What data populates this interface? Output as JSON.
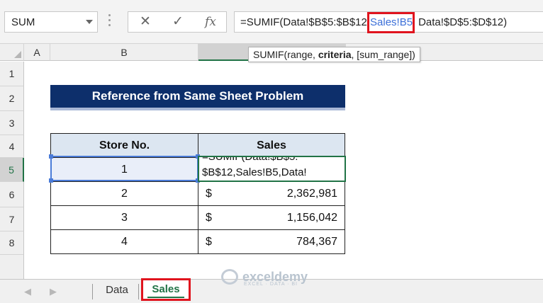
{
  "formula_bar": {
    "name_box": "SUM",
    "cancel_icon": "✕",
    "enter_icon": "✓",
    "fx_label": "fx",
    "formula_prefix": "=SUMIF(Data!$B$5:$B$12,",
    "formula_highlight": "Sales!B5",
    "formula_suffix": "Data!$D$5:$D$12)"
  },
  "columns": [
    "A",
    "B"
  ],
  "tooltip": {
    "prefix": "SUMIF(range, ",
    "bold": "criteria",
    "suffix": ", [sum_range])"
  },
  "rows": [
    "1",
    "2",
    "3",
    "4",
    "5",
    "6",
    "7",
    "8"
  ],
  "sheet": {
    "title": "Reference from Same Sheet Problem",
    "headers": [
      "Store No.",
      "Sales"
    ],
    "editing": {
      "store": "1",
      "line1": "=SUMIF(Data!$B$5:",
      "line2": "$B$12,Sales!B5,Data!"
    },
    "data_rows": [
      {
        "store": "2",
        "currency": "$",
        "sales": "2,362,981"
      },
      {
        "store": "3",
        "currency": "$",
        "sales": "1,156,042"
      },
      {
        "store": "4",
        "currency": "$",
        "sales": "784,367"
      }
    ]
  },
  "tabs": {
    "prev": "◀",
    "next": "▶",
    "items": [
      "Data",
      "Sales"
    ],
    "active": "Sales"
  },
  "watermark": {
    "name": "exceldemy",
    "tagline": "EXCEL · DATA · BI"
  },
  "colors": {
    "title_bg": "#0d2f6b",
    "header_bg": "#dce6f1",
    "excel_green": "#217346",
    "highlight_red": "#e0141e",
    "ref_blue": "#4a7bd8"
  }
}
